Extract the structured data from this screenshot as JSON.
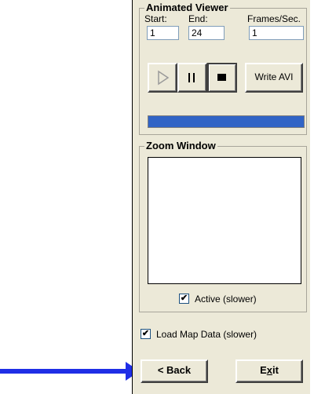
{
  "animated_viewer": {
    "title": "Animated Viewer",
    "start_label": "Start:",
    "end_label": "End:",
    "fps_label": "Frames/Sec.",
    "start_value": "1",
    "end_value": "24",
    "fps_value": "1",
    "play_icon": "play-icon",
    "pause_icon": "pause-icon",
    "stop_icon": "stop-icon",
    "write_avi_label": "Write AVI",
    "progress_fraction": 1.0
  },
  "zoom_window": {
    "title": "Zoom Window",
    "active_label": "Active (slower)",
    "active_checked": true
  },
  "load_map": {
    "label": "Load Map Data (slower)",
    "checked": true
  },
  "footer": {
    "back_label": "< Back",
    "exit_label": "Exit",
    "exit_mnemonic": "x"
  },
  "colors": {
    "panel_bg": "#ece9d8",
    "progress_fill": "#3164c6",
    "arrow": "#1f2ee6"
  }
}
